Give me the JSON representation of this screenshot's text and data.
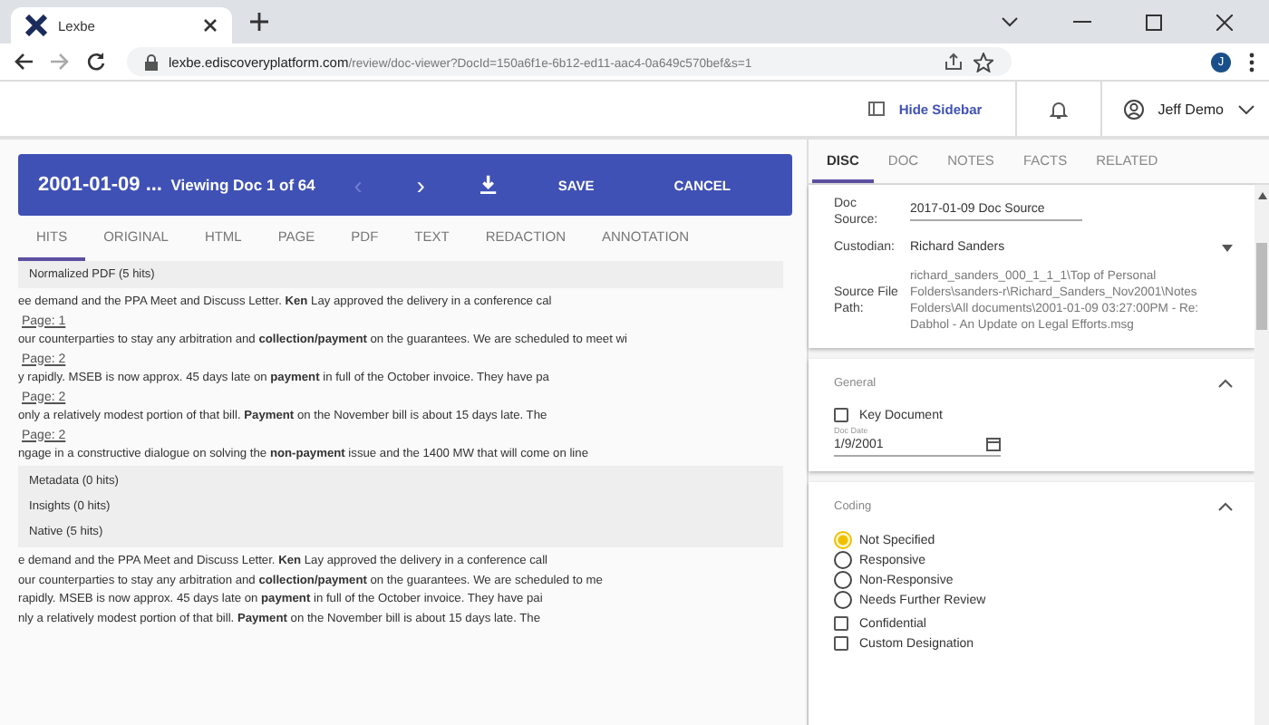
{
  "browser": {
    "tab_title": "Lexbe",
    "url_host": "lexbe.ediscoveryplatform.com",
    "url_path": "/review/doc-viewer?DocId=150a6f1e-6b12-ed11-aac4-0a649c570bef&s=1",
    "profile_initial": "J"
  },
  "header": {
    "hide_sidebar": "Hide Sidebar",
    "user": "Jeff Demo"
  },
  "toolbar": {
    "title": "2001-01-09 ...",
    "viewing": "Viewing Doc 1 of 64",
    "prev": "‹",
    "next": "›",
    "save": "SAVE",
    "cancel": "CANCEL"
  },
  "viewer_tabs": [
    {
      "label": "HITS",
      "selected": true
    },
    {
      "label": "ORIGINAL",
      "selected": false
    },
    {
      "label": "HTML",
      "selected": false
    },
    {
      "label": "PAGE",
      "selected": false
    },
    {
      "label": "PDF",
      "selected": false
    },
    {
      "label": "TEXT",
      "selected": false
    },
    {
      "label": "REDACTION",
      "selected": false
    },
    {
      "label": "ANNOTATION",
      "selected": false
    }
  ],
  "hits": {
    "section": "Normalized PDF (5 hits)",
    "items": [
      {
        "kind": "snippet",
        "text": "ee demand and the PPA Meet and Discuss Letter. **Ken** Lay approved the delivery in a conference cal"
      },
      {
        "kind": "page",
        "text": "Page: 1"
      },
      {
        "kind": "snippet",
        "text": "our counterparties to stay any arbitration and **collection/payment** on the guarantees. We are scheduled to meet wi"
      },
      {
        "kind": "page",
        "text": "Page: 2"
      },
      {
        "kind": "snippet",
        "text": "y rapidly. MSEB is now approx. 45 days late on **payment** in full of the October invoice. They have pa"
      },
      {
        "kind": "page",
        "text": "Page: 2"
      },
      {
        "kind": "snippet",
        "text": "only a relatively modest portion of that bill. **Payment** on the November bill is about 15 days late. The"
      },
      {
        "kind": "page",
        "text": "Page: 2"
      },
      {
        "kind": "snippet",
        "text": "ngage in a constructive dialogue on solving the **non-payment** issue and the 1400 MW that will come on line"
      }
    ],
    "groups": [
      "Metadata (0 hits)",
      "Insights (0 hits)",
      "Native (5 hits)"
    ],
    "native_snippets": [
      "e demand and the PPA Meet and Discuss Letter. **Ken** Lay approved the delivery in a conference call",
      "our counterparties to stay any arbitration and **collection/payment** on the guarantees. We are scheduled to me",
      "rapidly. MSEB is now approx. 45 days late on **payment** in full of the October invoice. They have pai",
      "nly a relatively modest portion of that bill. **Payment** on the November bill is about 15 days late. The"
    ]
  },
  "side_tabs": [
    {
      "label": "DISC",
      "selected": true
    },
    {
      "label": "DOC",
      "selected": false
    },
    {
      "label": "NOTES",
      "selected": false
    },
    {
      "label": "FACTS",
      "selected": false
    },
    {
      "label": "RELATED",
      "selected": false
    }
  ],
  "disc": {
    "doc_source_label": "Doc Source:",
    "doc_source": "2017-01-09 Doc Source",
    "custodian_label": "Custodian:",
    "custodian": "Richard Sanders",
    "path_label": "Source File Path:",
    "path": "richard_sanders_000_1_1_1\\Top of Personal Folders\\sanders-r\\Richard_Sanders_Nov2001\\Notes Folders\\All documents\\2001-01-09 03:27:00PM - Re: Dabhol - An Update on Legal Efforts.msg"
  },
  "general": {
    "title": "General",
    "key_document": {
      "label": "Key Document",
      "checked": false
    },
    "doc_date_label": "Doc Date",
    "doc_date": "1/9/2001"
  },
  "coding": {
    "title": "Coding",
    "options": [
      {
        "label": "Not Specified",
        "selected": true
      },
      {
        "label": "Responsive",
        "selected": false
      },
      {
        "label": "Non-Responsive",
        "selected": false
      },
      {
        "label": "Needs Further Review",
        "selected": false
      }
    ],
    "checks": [
      {
        "label": "Confidential",
        "checked": false
      },
      {
        "label": "Custom Designation",
        "checked": false
      }
    ]
  }
}
